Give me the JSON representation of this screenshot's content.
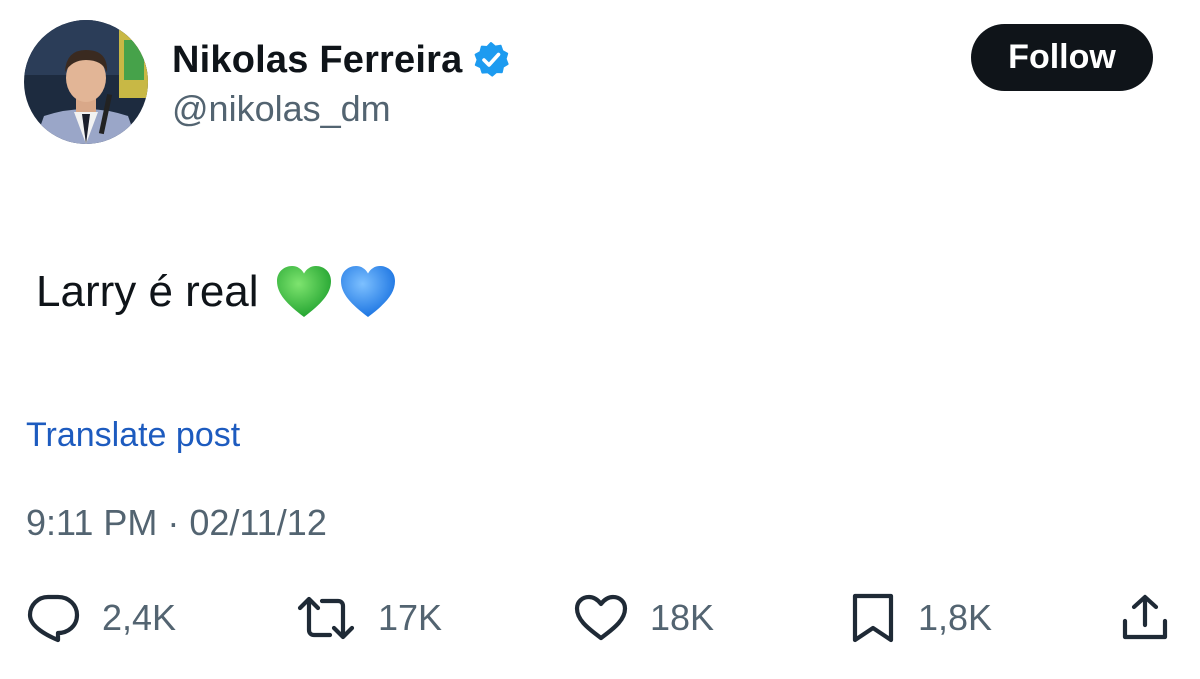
{
  "author": {
    "display_name": "Nikolas Ferreira",
    "handle": "@nikolas_dm",
    "verified": true
  },
  "follow_button": {
    "label": "Follow"
  },
  "post": {
    "text": "Larry é real",
    "emojis": [
      "green-heart",
      "blue-heart"
    ],
    "translate_label": "Translate post",
    "timestamp": "9:11 PM · 02/11/12"
  },
  "actions": {
    "replies": "2,4K",
    "reposts": "17K",
    "likes": "18K",
    "bookmarks": "1,8K"
  },
  "icons": {
    "verified": "verified-badge-icon",
    "reply": "reply-icon",
    "repost": "repost-icon",
    "like": "heart-icon",
    "bookmark": "bookmark-icon",
    "share": "share-icon"
  },
  "colors": {
    "text_primary": "#0f1419",
    "text_secondary": "#536471",
    "link": "#1d5bbf",
    "verified_badge": "#1d9bf0",
    "follow_bg": "#0f1419",
    "green_heart": "#2fbf3a",
    "blue_heart": "#2a8cf0"
  }
}
